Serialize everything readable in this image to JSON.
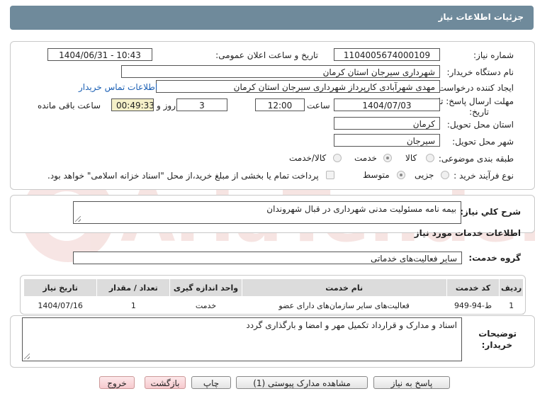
{
  "window": {
    "title": "جزئیات اطلاعات نیاز"
  },
  "form": {
    "need_number": {
      "label": "شماره نیاز:",
      "value": "1104005674000109"
    },
    "announce_datetime": {
      "label": "تاریخ و ساعت اعلان عمومی:",
      "value": "1404/06/31 - 10:43"
    },
    "buyer_org": {
      "label": "نام دستگاه خریدار:",
      "value": "شهرداری سیرجان استان کرمان"
    },
    "requester": {
      "label": "ایجاد کننده درخواست:",
      "value": "مهدی شهرآبادی کارپرداز شهرداری سیرجان استان کرمان",
      "contact_link": "اطلاعات تماس خریدار"
    },
    "deadline": {
      "label_line1": "مهلت ارسال پاسخ: تا",
      "label_line2": "تاریخ:",
      "date": "1404/07/03",
      "time_label": "ساعت",
      "time": "12:00",
      "days": "3",
      "days_label": "روز و",
      "remaining": "00:49:33",
      "remaining_label": "ساعت باقی مانده"
    },
    "province": {
      "label": "استان محل تحویل:",
      "value": "کرمان"
    },
    "city": {
      "label": "شهر محل تحویل:",
      "value": "سیرجان"
    },
    "category": {
      "label": "طبقه بندی موضوعی:",
      "options": [
        "کالا",
        "خدمت",
        "کالا/خدمت"
      ],
      "selected": "خدمت"
    },
    "process_type": {
      "label": "نوع فرآیند خرید :",
      "options": [
        "جزیی",
        "متوسط"
      ],
      "selected": "متوسط",
      "payment_note": "پرداخت تمام یا بخشی از مبلغ خرید،از محل \"اسناد خزانه اسلامی\" خواهد بود."
    }
  },
  "need_description": {
    "label": "شرح کلي نياز:",
    "value": "بیمه نامه مسئولیت مدنی شهرداری در قبال شهروندان"
  },
  "services": {
    "section_title": "اطلاعات خدمات مورد نياز",
    "group_label": "گروه خدمت:",
    "group_value": "سایر فعالیت‌های خدماتی",
    "table": {
      "headers": [
        "ردیف",
        "کد خدمت",
        "نام خدمت",
        "واحد اندازه گیری",
        "تعداد / مقدار",
        "تاریخ نیاز"
      ],
      "rows": [
        [
          "1",
          "ط-94-949",
          "فعالیت‌های سایر سازمان‌های دارای عضو",
          "خدمت",
          "1",
          "1404/07/16"
        ]
      ]
    }
  },
  "buyer_notes": {
    "label_line1": "توضیحات",
    "label_line2": "خریدار:",
    "value": "اسناد و مدارک و قرارداد تکمیل مهر و امضا و بارگذاری گردد"
  },
  "buttons": {
    "reply": "پاسخ به نیاز",
    "view_docs": "مشاهده مدارک پیوستی (1)",
    "print": "چاپ",
    "back": "بازگشت",
    "exit": "خروج"
  },
  "watermark": {
    "text": "AriaTender.neT"
  },
  "colors": {
    "titlebar": "#6f8a9b",
    "link": "#1a5fb4",
    "remaining_bg": "#f5f0c8",
    "exit_button": "#f6c9ce"
  }
}
